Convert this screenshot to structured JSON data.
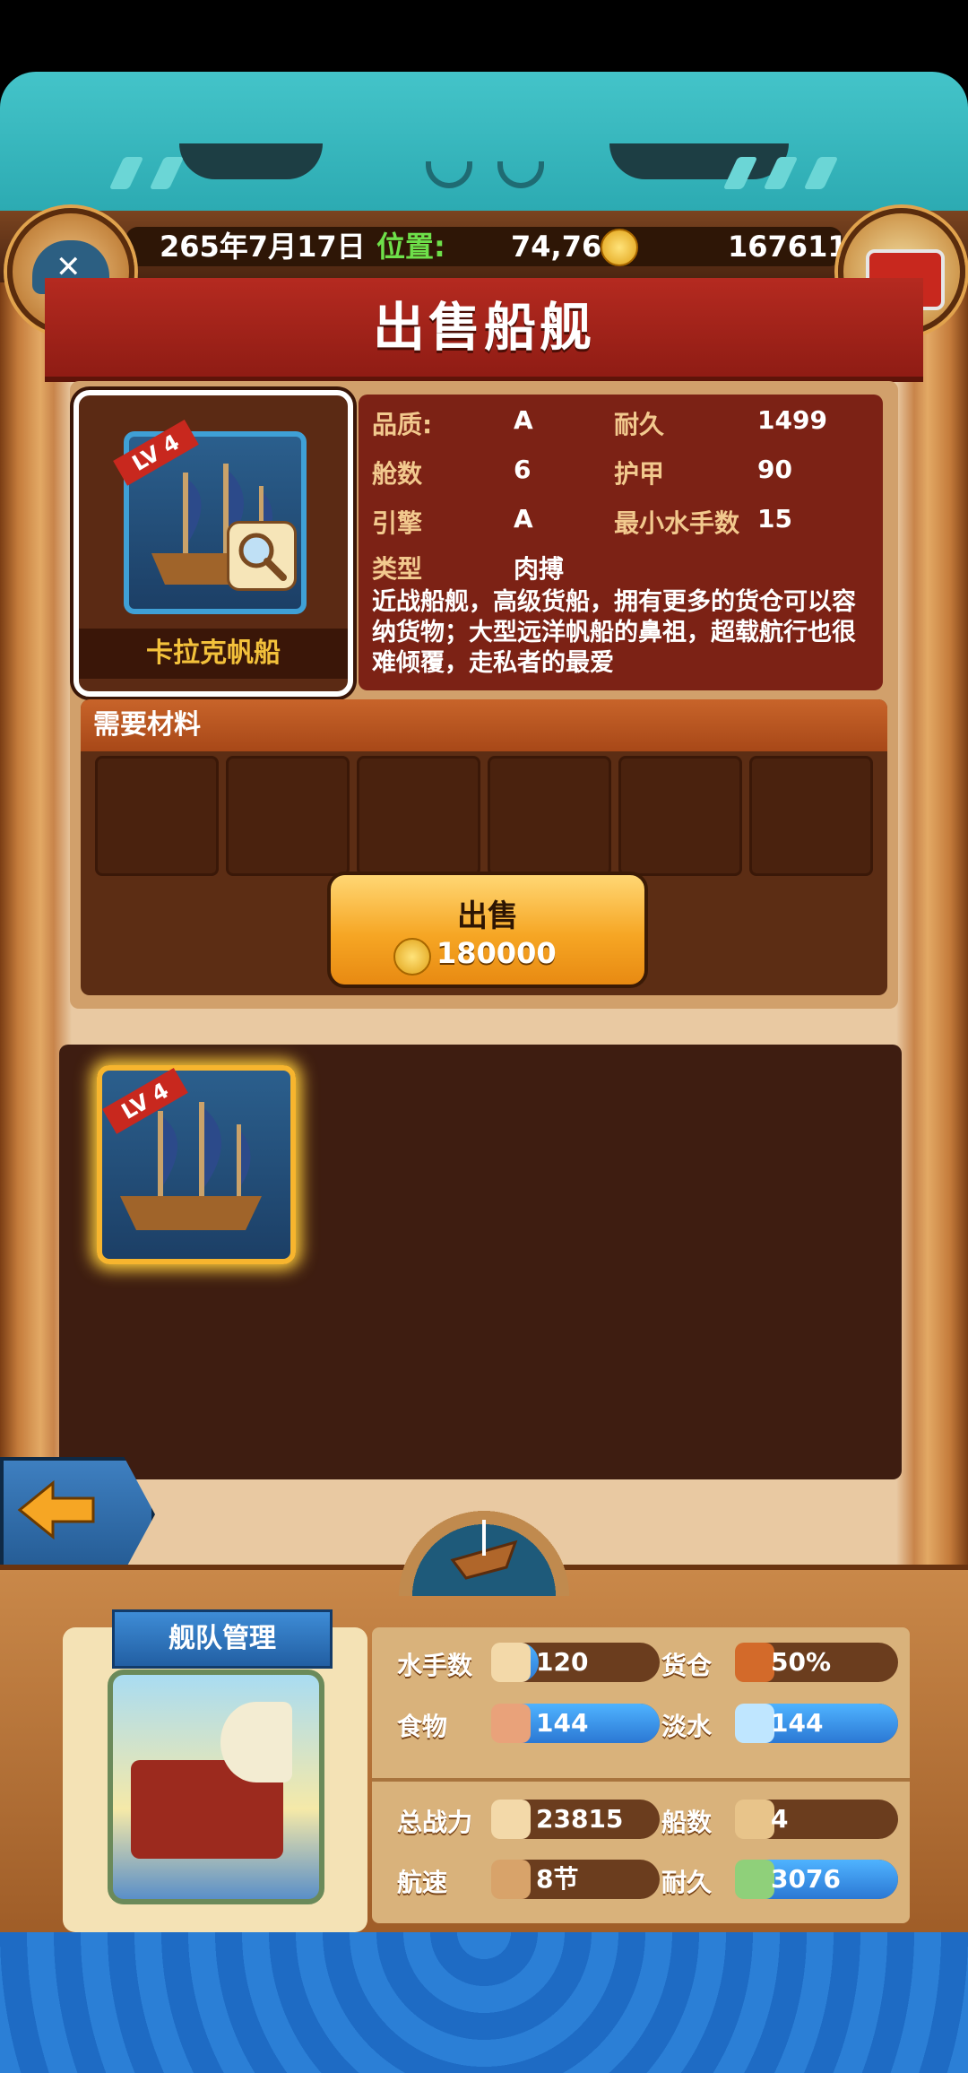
{
  "header": {
    "date": "265年7月17日",
    "position_label": "位置:",
    "position_value": "74,76",
    "gold": "167611"
  },
  "title": "出售船舰",
  "ship": {
    "level": "LV 4",
    "name": "卡拉克帆船",
    "stats": [
      {
        "label": "品质:",
        "value": "A"
      },
      {
        "label": "耐久",
        "value": "1499"
      },
      {
        "label": "舱数",
        "value": "6"
      },
      {
        "label": "护甲",
        "value": "90"
      },
      {
        "label": "引擎",
        "value": "A"
      },
      {
        "label": "最小水手数",
        "value": "15"
      },
      {
        "label": "类型",
        "value": "肉搏"
      }
    ],
    "description": "近战船舰，高级货船，拥有更多的货仓可以容纳货物；大型远洋帆船的鼻祖，超载航行也很难倾覆，走私者的最爱"
  },
  "materials": {
    "title": "需要材料",
    "slot_count": 6
  },
  "sell_button": {
    "label": "出售",
    "price": "180000"
  },
  "inventory": [
    {
      "level": "LV 4"
    }
  ],
  "fleet": {
    "title": "舰队管理",
    "stats": [
      {
        "label": "水手数",
        "value": "120",
        "fill": 0.25,
        "icon": "sailor-icon"
      },
      {
        "label": "货仓",
        "value": "50%",
        "fill": 0.15,
        "icon": "cargo-icon"
      },
      {
        "label": "食物",
        "value": "144",
        "fill": 1.0,
        "icon": "meat-icon"
      },
      {
        "label": "淡水",
        "value": "144",
        "fill": 1.0,
        "icon": "water-icon"
      },
      {
        "label": "总战力",
        "value": "23815",
        "fill": 0.0,
        "icon": "swords-icon"
      },
      {
        "label": "船数",
        "value": "4",
        "fill": 0.0,
        "icon": "boat-icon"
      },
      {
        "label": "航速",
        "value": "8节",
        "fill": 0.0,
        "icon": "speed-icon"
      },
      {
        "label": "耐久",
        "value": "3076",
        "fill": 1.0,
        "icon": "durability-icon"
      }
    ]
  },
  "colors": {
    "accent_gold": "#f3c13b",
    "title_red": "#b52a20",
    "bar_blue": "#2b78d4"
  }
}
